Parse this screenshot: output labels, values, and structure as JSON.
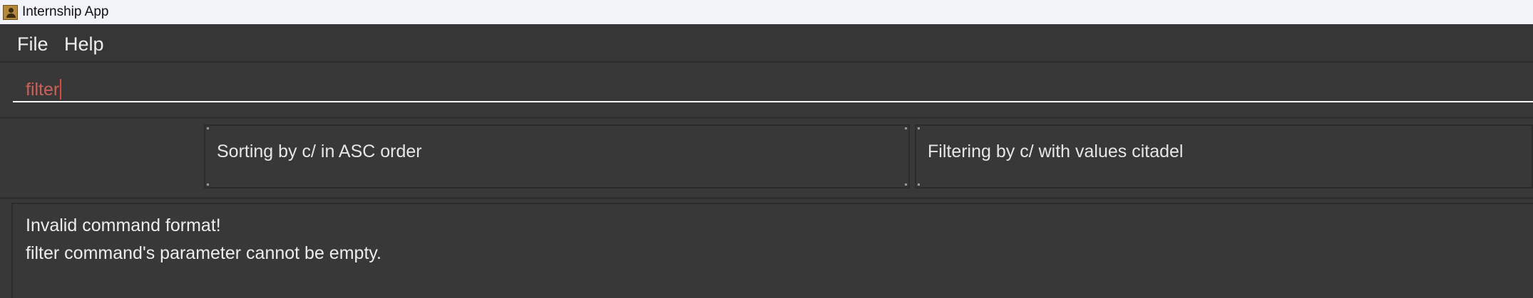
{
  "window": {
    "title": "Internship App",
    "app_icon": "person-badge-icon"
  },
  "menu": {
    "items": [
      "File",
      "Help"
    ]
  },
  "command_box": {
    "value": "filter",
    "text_color": "#c8625a"
  },
  "status_panels": {
    "sort_text": "Sorting by c/ in ASC order",
    "filter_text": "Filtering by c/ with values citadel"
  },
  "result": {
    "lines": [
      "Invalid command format!",
      "filter command's parameter cannot be empty."
    ]
  }
}
